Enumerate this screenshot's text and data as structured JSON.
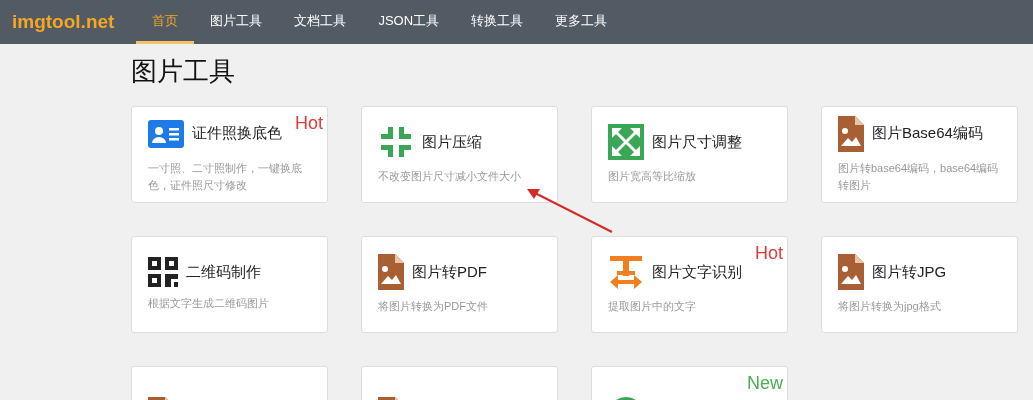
{
  "logo": "imgtool.net",
  "nav": [
    {
      "label": "首页",
      "selected": true
    },
    {
      "label": "图片工具",
      "selected": false
    },
    {
      "label": "文档工具",
      "selected": false
    },
    {
      "label": "JSON工具",
      "selected": false
    },
    {
      "label": "转换工具",
      "selected": false
    },
    {
      "label": "更多工具",
      "selected": false
    }
  ],
  "heading": "图片工具",
  "tools": [
    {
      "kind": "idcard",
      "title": "证件照换底色",
      "description": "一寸照、二寸照制作，一键换底色，证件照尺寸修改",
      "badge": {
        "kind": "hot",
        "text": "Hot"
      }
    },
    {
      "kind": "compress",
      "title": "图片压缩",
      "description": "不改变图片尺寸减小文件大小"
    },
    {
      "kind": "resize",
      "title": "图片尺寸调整",
      "description": "图片宽高等比缩放"
    },
    {
      "kind": "imagefile",
      "title": "图片Base64编码",
      "description": "图片转base64编码，base64编码转图片"
    },
    {
      "kind": "qrcode",
      "title": "二维码制作",
      "description": "根据文字生成二维码图片"
    },
    {
      "kind": "imagefile",
      "title": "图片转PDF",
      "description": "将图片转换为PDF文件"
    },
    {
      "kind": "ocr",
      "title": "图片文字识别",
      "description": "提取图片中的文字",
      "badge": {
        "kind": "hot",
        "text": "Hot"
      }
    },
    {
      "kind": "imagefile",
      "title": "图片转JPG",
      "description": "将图片转换为jpg格式"
    },
    {
      "kind": "imagefile"
    },
    {
      "kind": "imagefile"
    },
    {
      "kind": "circle",
      "badge": {
        "kind": "new",
        "text": "New"
      }
    }
  ]
}
